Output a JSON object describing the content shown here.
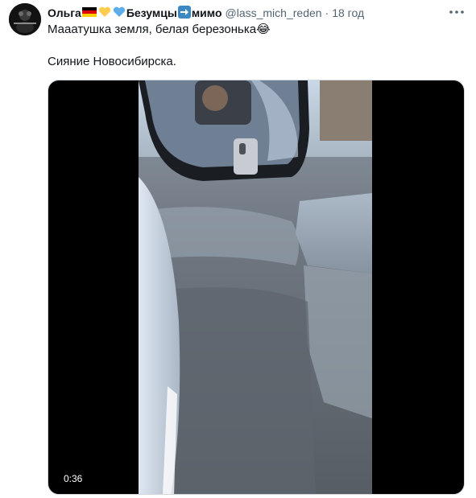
{
  "tweet": {
    "author": {
      "name_part1": "Ольга",
      "name_part2": "Безумцы",
      "name_part3": "мимо",
      "handle": "@lass_mich_reden",
      "avatar_icon": "avatar-image"
    },
    "separator": "·",
    "time": "18 год",
    "text_line1": "Мааатушка земля, белая березонька😂",
    "text_line2": "Сияние Новосибирска.",
    "media": {
      "type": "video",
      "duration": "0:36"
    },
    "more_icon": "more-options-icon"
  },
  "colors": {
    "text_primary": "#0f1419",
    "text_secondary": "#536471",
    "media_background": "#000000"
  }
}
